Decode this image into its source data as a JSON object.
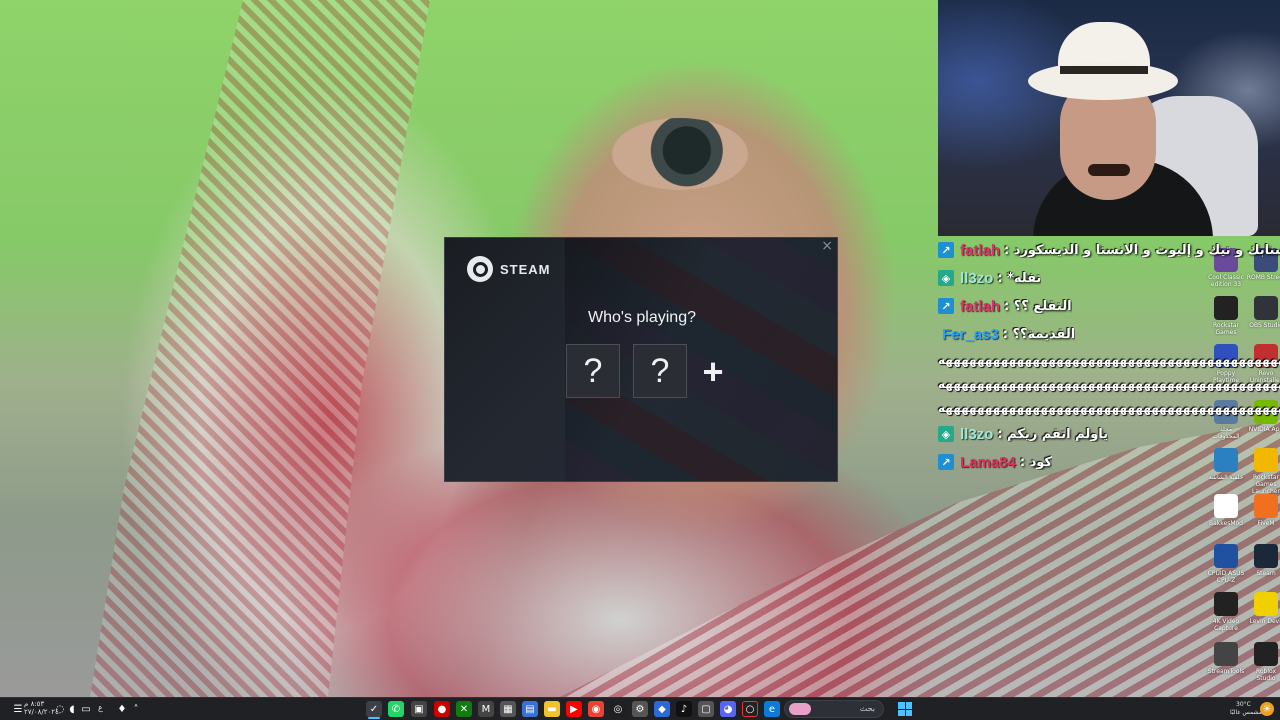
{
  "dialog": {
    "brand": "STEAM",
    "prompt": "Who's playing?",
    "profile_1": "?",
    "profile_2": "?",
    "add": "+",
    "close": "×"
  },
  "chat": [
    {
      "user": "fatlah",
      "user_color": "#e0306a",
      "badge": "blue",
      "message": ": ما حطيت سنابك و تيك و إليوت و الانستا و الديسكورد"
    },
    {
      "user": "ll3zo",
      "user_color": "#9fe7d8",
      "badge": "teal",
      "message": ": *تفله"
    },
    {
      "user": "fatlah",
      "user_color": "#e0306a",
      "badge": "blue",
      "message": ": التقلع ؟؟"
    },
    {
      "user": "Fer_as3",
      "user_color": "#2aa3ff",
      "badge": "none",
      "message": ": القديمة؟؟"
    },
    {
      "user": "ll3zo",
      "user_color": "#9fe7d8",
      "badge": "teal",
      "message": ": ياولم اتقم ريكم"
    },
    {
      "user": "Lama84",
      "user_color": "#e0305a",
      "badge": "blue",
      "message": ": كود"
    }
  ],
  "chat_spam": [
    "ههههههههههههههههههههههههههههههههههههههههههههههههههههههههههههههههههههه",
    "ههههههههههههههههههههههههههههههههههههههههههههههههههههههههههههههههههههه",
    "ههههههههههههههههههههههههههههههههههههههههههههههههههههههههههههههههههه"
  ],
  "desktop_icons": [
    {
      "label": "ROMB Street",
      "icon": "rom-icon",
      "color": "#3b4b7a"
    },
    {
      "label": "Cool Classic edition 33",
      "icon": "archive-icon",
      "color": "#6a4a9a"
    },
    {
      "label": "OBS Studio",
      "icon": "obs-icon",
      "color": "#30343a"
    },
    {
      "label": "Rockstar Games",
      "icon": "rockstar-icon",
      "color": "#222222"
    },
    {
      "label": "Revo Uninstaller",
      "icon": "revo-icon",
      "color": "#c03030"
    },
    {
      "label": "Poppy Playtime",
      "icon": "poppy-icon",
      "color": "#3050c0"
    },
    {
      "label": "NVIDIA App",
      "icon": "nvidia-icon",
      "color": "#76b900"
    },
    {
      "label": "مجلد المحذوفات",
      "icon": "recycle-icon",
      "color": "#5a7aa0"
    },
    {
      "label": "Rockstar Games Launcher",
      "icon": "rockstar-launcher-icon",
      "color": "#f2b800"
    },
    {
      "label": "خلفية الشاشة",
      "icon": "wallpaper-icon",
      "color": "#2a80c0"
    },
    {
      "label": "FiveM",
      "icon": "fivem-icon",
      "color": "#f07020"
    },
    {
      "label": "BakkesMod",
      "icon": "bakkesmod-icon",
      "color": "#ffffff"
    },
    {
      "label": "Steam",
      "icon": "steam-icon",
      "color": "#1b2838"
    },
    {
      "label": "CPUID ASUS CPU-Z",
      "icon": "cpuz-icon",
      "color": "#2050a0"
    },
    {
      "label": "Levin Devil",
      "icon": "levin-icon",
      "color": "#f0d000"
    },
    {
      "label": "4K Video Capture",
      "icon": "4k-icon",
      "color": "#222222"
    },
    {
      "label": "Roblox Studio",
      "icon": "roblox-icon",
      "color": "#222222"
    },
    {
      "label": "StreamTools",
      "icon": "streamtools-icon",
      "color": "#444444"
    }
  ],
  "taskbar": {
    "search_label": "بحث",
    "clock_time": "٨:٥٣ م",
    "clock_date": "٢٧/٠٨/٢٠٢٤",
    "weather_temp": "30°C",
    "weather_desc": "مشمس غالبًا",
    "lang": "ع"
  },
  "colors": {
    "steam_bg": "#1b1f25",
    "accent": "#4cc2ff",
    "taskbar_bg": "#1f2125"
  }
}
